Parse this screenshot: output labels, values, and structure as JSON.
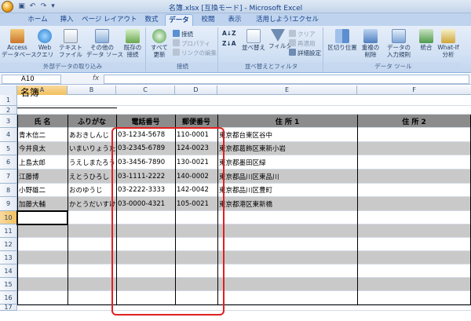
{
  "window": {
    "title": "名簿.xlsx [互換モード] - Microsoft Excel"
  },
  "tabs": [
    "ホーム",
    "挿入",
    "ページ レイアウト",
    "数式",
    "データ",
    "校閲",
    "表示",
    "活用しよう!エクセル"
  ],
  "active_tab": "データ",
  "ribbon": {
    "group_external": {
      "label": "外部データの取り込み",
      "access": "Access\nデータベース",
      "web": "Web\nクエリ",
      "text": "テキスト\nファイル",
      "other": "その他の\nデータ ソース",
      "existing": "既存の\n接続"
    },
    "group_connections": {
      "label": "接続",
      "refresh": "すべて\n更新",
      "connections": "接続",
      "properties": "プロパティ",
      "edit_links": "リンクの編集"
    },
    "group_sort": {
      "label": "並べ替えとフィルタ",
      "sort": "並べ替え",
      "filter": "フィルタ",
      "clear": "クリア",
      "reapply": "再適用",
      "advanced": "詳細設定"
    },
    "group_tools": {
      "label": "データ ツール",
      "text_to_columns": "区切り位置",
      "remove_dup": "重複の\n削除",
      "validation": "データの\n入力規則",
      "consolidate": "統合",
      "whatif": "What-If\n分析"
    }
  },
  "formula_bar": {
    "name_box": "A10",
    "fx": "fx",
    "formula": ""
  },
  "columns": [
    "A",
    "B",
    "C",
    "D",
    "E",
    "F"
  ],
  "rows": [
    "1",
    "2",
    "3",
    "4",
    "5",
    "6",
    "7",
    "8",
    "9",
    "10",
    "11",
    "12",
    "13",
    "14",
    "15",
    "16",
    "17"
  ],
  "sheet": {
    "title": "名簿",
    "headers": [
      "氏 名",
      "ふりがな",
      "電話番号",
      "郵便番号",
      "住 所 1",
      "住 所 2"
    ],
    "records": [
      [
        "青木信二",
        "あおきしんじ",
        "03-1234-5678",
        "110-0001",
        "東京都台東区谷中",
        ""
      ],
      [
        "今井良太",
        "いまいりょうた",
        "03-2345-6789",
        "124-0023",
        "東京都葛飾区東新小岩",
        ""
      ],
      [
        "上島太郎",
        "うえしまたろう",
        "03-3456-7890",
        "130-0021",
        "東京都墨田区緑",
        ""
      ],
      [
        "江藤博",
        "えとうひろし",
        "03-1111-2222",
        "140-0002",
        "東京都品川区東品川",
        ""
      ],
      [
        "小野雄二",
        "おのゆうじ",
        "03-2222-3333",
        "142-0042",
        "東京都品川区豊町",
        ""
      ],
      [
        "加藤大輔",
        "かとうだいすけ",
        "03-0000-4321",
        "105-0021",
        "東京都港区東新橋",
        ""
      ]
    ]
  },
  "colors": {
    "highlight": "#e02020",
    "header_fill": "#8c8c8c",
    "band_fill": "#c9c9c9"
  }
}
